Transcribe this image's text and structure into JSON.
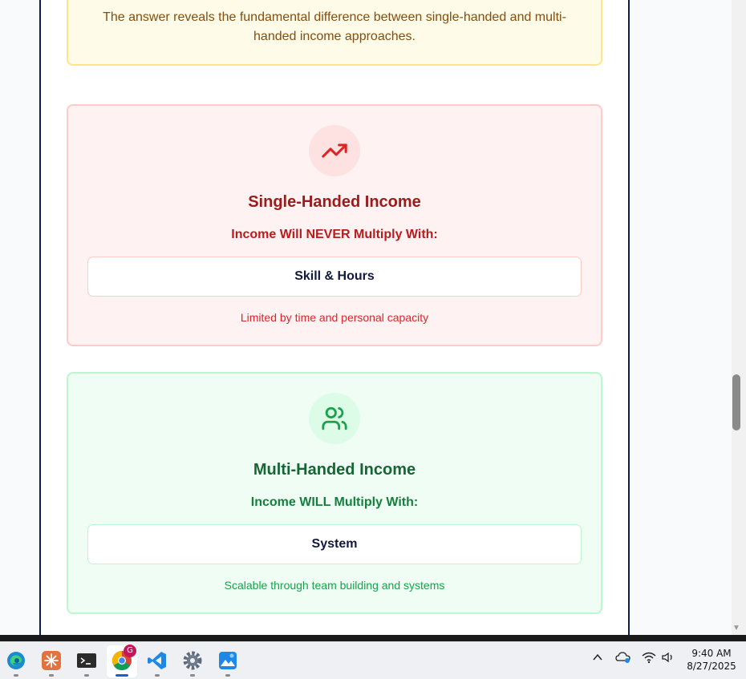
{
  "note": {
    "text": "The answer reveals the fundamental difference between single-handed and multi-handed income approaches."
  },
  "single": {
    "icon": "trending-up-icon",
    "title": "Single-Handed Income",
    "subtitle": "Income Will NEVER Multiply With:",
    "value": "Skill & Hours",
    "note": "Limited by time and personal capacity",
    "accent": "#dc2626"
  },
  "multi": {
    "icon": "users-icon",
    "title": "Multi-Handed Income",
    "subtitle": "Income WILL Multiply With:",
    "value": "System",
    "note": "Scalable through team building and systems",
    "accent": "#16a34a"
  },
  "taskbar": {
    "apps": [
      "edge-icon",
      "claude-icon",
      "terminal-icon",
      "chrome-icon",
      "vscode-icon",
      "settings-icon",
      "photos-icon"
    ],
    "chrome_badge": "G",
    "time": "9:40 AM",
    "date": "8/27/2025"
  }
}
